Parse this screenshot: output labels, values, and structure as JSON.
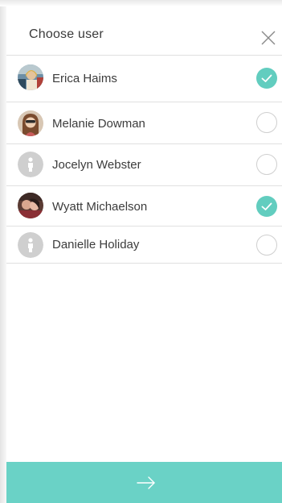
{
  "header": {
    "title": "Choose user",
    "close_icon": "close-icon"
  },
  "users": [
    {
      "name": "Erica Haims",
      "avatar": "photo",
      "selected": true
    },
    {
      "name": "Melanie Dowman",
      "avatar": "photo",
      "selected": false
    },
    {
      "name": "Jocelyn Webster",
      "avatar": "placeholder-person-icon",
      "selected": false
    },
    {
      "name": "Wyatt Michaelson",
      "avatar": "photo",
      "selected": true
    },
    {
      "name": "Danielle Holiday",
      "avatar": "placeholder-person-icon",
      "selected": false
    }
  ],
  "footer": {
    "icon": "arrow-right-icon"
  },
  "colors": {
    "accent": "#62cdbf",
    "footer": "#6ad2c6",
    "divider": "#e0e0e0",
    "text": "#3c3c3c",
    "placeholder_avatar": "#cfcfcf"
  }
}
